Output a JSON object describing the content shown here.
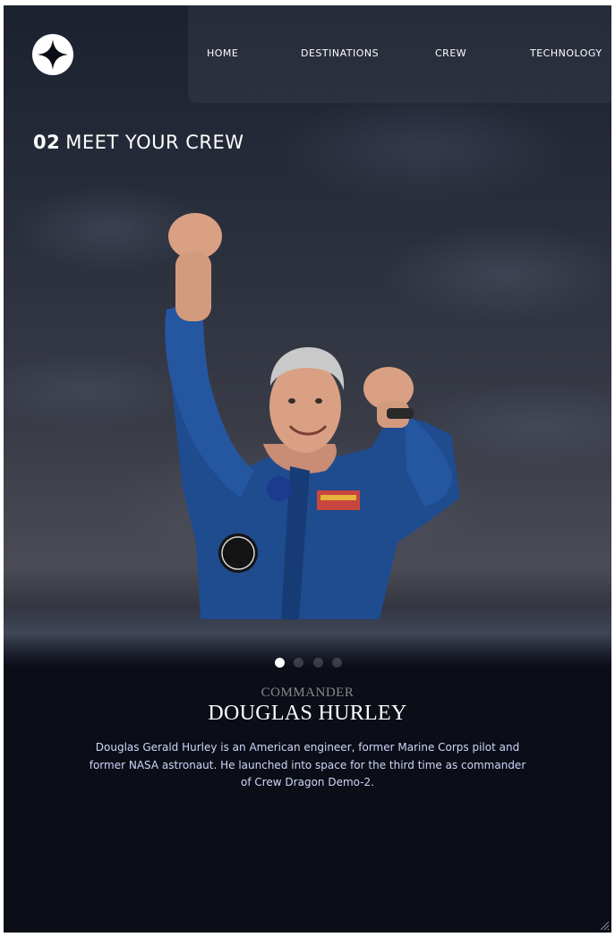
{
  "nav": {
    "logo_icon": "star-logo-icon",
    "items": [
      {
        "label": "HOME"
      },
      {
        "label": "DESTINATIONS"
      },
      {
        "label": "CREW"
      },
      {
        "label": "TECHNOLOGY"
      }
    ]
  },
  "page": {
    "number": "02",
    "title": "MEET YOUR CREW"
  },
  "crew": {
    "slides_total": 4,
    "active_slide": 1,
    "role": "COMMANDER",
    "name": "DOUGLAS HURLEY",
    "bio": "Douglas Gerald Hurley is an American engineer, former Marine Corps pilot and former NASA astronaut. He launched into space for the third time as commander of Crew Dragon Demo-2."
  },
  "colors": {
    "background": "#0b0d17",
    "text_light": "#d0d6f9",
    "white": "#ffffff"
  }
}
